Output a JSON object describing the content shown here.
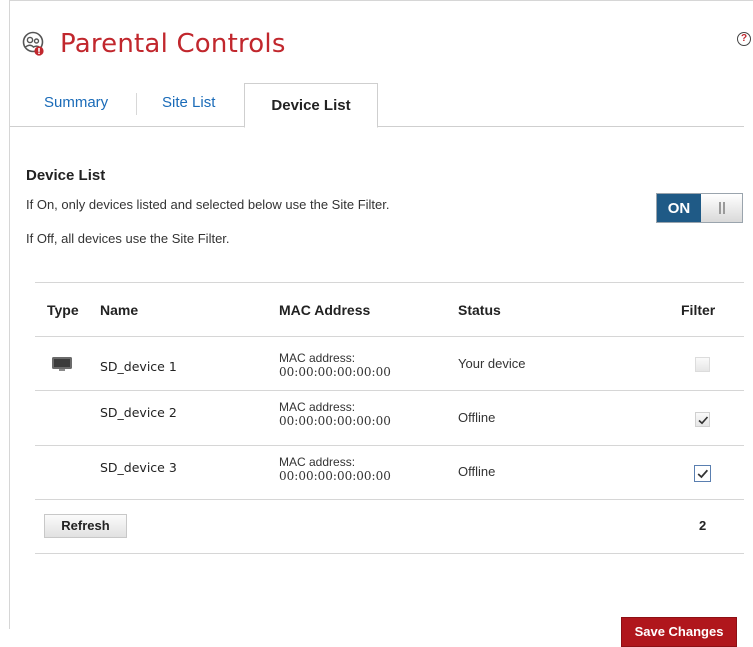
{
  "header": {
    "title": "Parental Controls",
    "help_label": "?"
  },
  "tabs": [
    {
      "label": "Summary",
      "active": false
    },
    {
      "label": "Site List",
      "active": false
    },
    {
      "label": "Device List",
      "active": true
    }
  ],
  "section": {
    "title": "Device List",
    "desc_on": "If On, only devices listed and selected below use the Site Filter.",
    "desc_off": "If Off, all devices use the Site Filter.",
    "toggle_label": "ON",
    "toggle_state": true
  },
  "table": {
    "headers": {
      "type": "Type",
      "name": "Name",
      "mac": "MAC Address",
      "status": "Status",
      "filter": "Filter"
    },
    "rows": [
      {
        "icon": "tv-icon",
        "name": "SD_device 1",
        "mac_label": "MAC address:",
        "mac": "00:00:00:00:00:00",
        "status": "Your device",
        "filter": false,
        "filter_disabled": true
      },
      {
        "icon": "",
        "name": "SD_device 2",
        "mac_label": "MAC address:",
        "mac": "00:00:00:00:00:00",
        "status": "Offline",
        "filter": true,
        "filter_disabled": false
      },
      {
        "icon": "",
        "name": "SD_device 3",
        "mac_label": "MAC address:",
        "mac": "00:00:00:00:00:00",
        "status": "Offline",
        "filter": true,
        "filter_disabled": false
      }
    ],
    "refresh_label": "Refresh",
    "selected_count": "2"
  },
  "footer": {
    "save_label": "Save Changes"
  },
  "colors": {
    "brand_red": "#c1272d",
    "link_blue": "#1a6bb8",
    "toggle_blue": "#1f5a86",
    "save_red": "#b0161c"
  }
}
